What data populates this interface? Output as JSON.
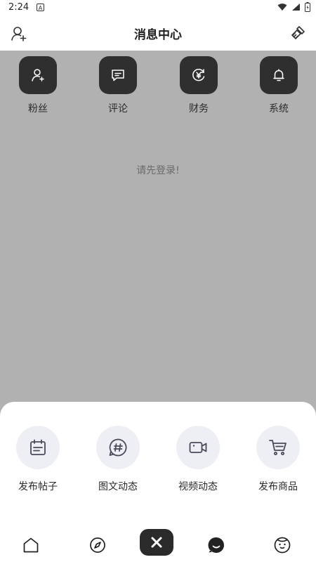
{
  "status_bar": {
    "time": "2:24",
    "app_icon_letter": "A"
  },
  "header": {
    "title": "消息中心"
  },
  "categories": [
    {
      "label": "粉丝",
      "icon": "fans-icon"
    },
    {
      "label": "评论",
      "icon": "comment-icon"
    },
    {
      "label": "财务",
      "icon": "finance-icon"
    },
    {
      "label": "系统",
      "icon": "system-bell-icon"
    }
  ],
  "login_tip": "请先登录!",
  "publish_actions": [
    {
      "label": "发布帖子",
      "icon": "post-icon"
    },
    {
      "label": "图文动态",
      "icon": "hashtag-icon"
    },
    {
      "label": "视频动态",
      "icon": "video-icon"
    },
    {
      "label": "发布商品",
      "icon": "cart-icon"
    }
  ],
  "tab_bar": [
    "home-icon",
    "discover-icon",
    "close-icon",
    "message-icon",
    "profile-icon"
  ],
  "colors": {
    "overlay": "#b1b1b1",
    "dark_tile": "#2f2f2f",
    "action_circle": "#eeeff5",
    "icon_stroke": "#4a4a5a"
  }
}
